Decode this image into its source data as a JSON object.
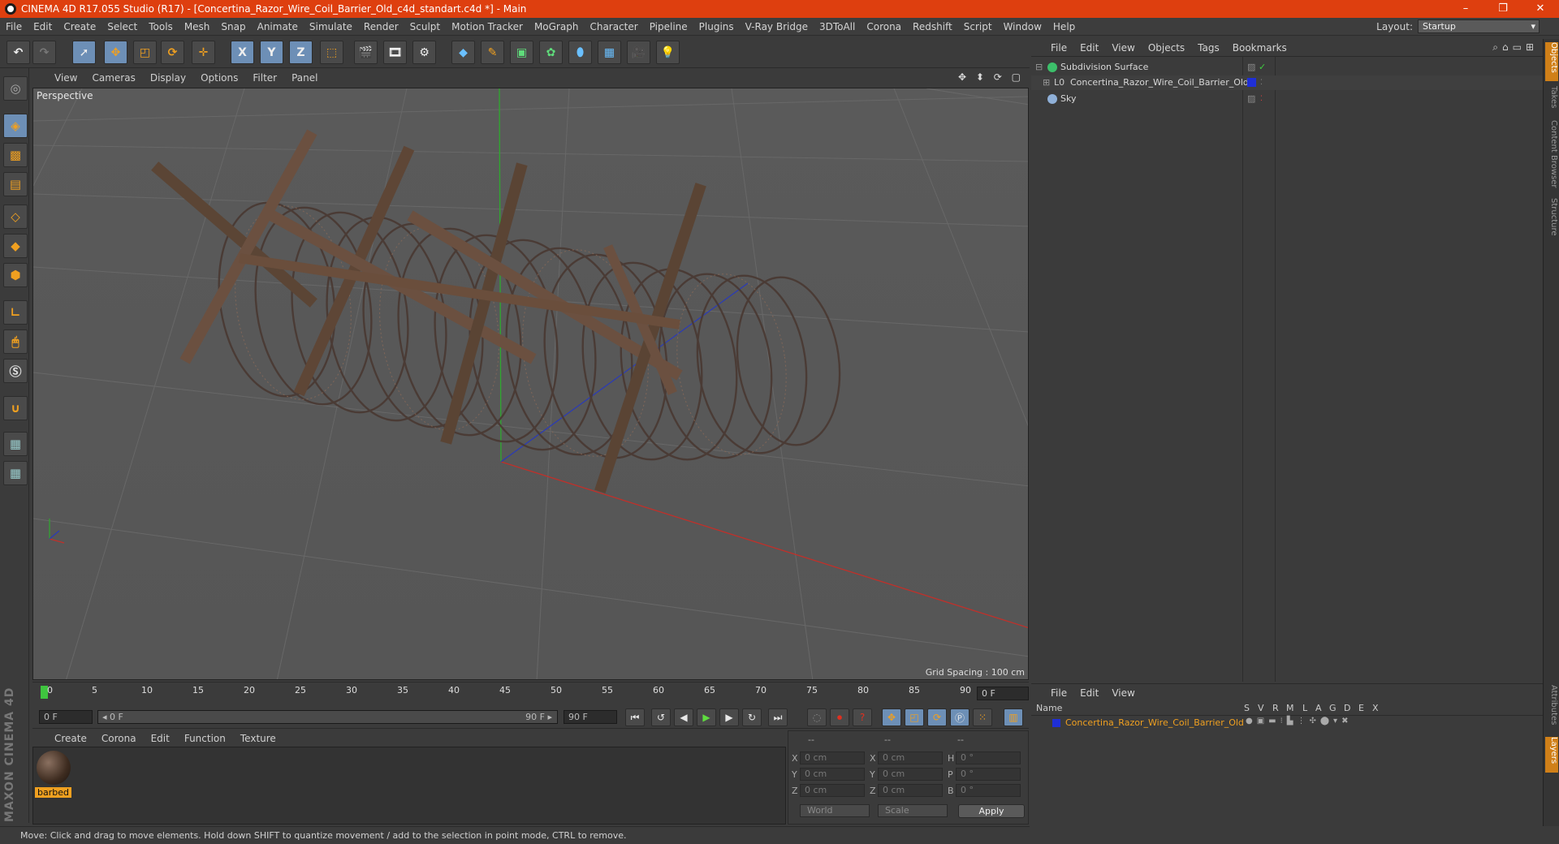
{
  "window": {
    "title": "CINEMA 4D R17.055 Studio (R17) - [Concertina_Razor_Wire_Coil_Barrier_Old_c4d_standart.c4d *] - Main",
    "controls": [
      "–",
      "❐",
      "✕"
    ]
  },
  "menu": {
    "items": [
      "File",
      "Edit",
      "Create",
      "Select",
      "Tools",
      "Mesh",
      "Snap",
      "Animate",
      "Simulate",
      "Render",
      "Sculpt",
      "Motion Tracker",
      "MoGraph",
      "Character",
      "Pipeline",
      "Plugins",
      "V-Ray Bridge",
      "3DToAll",
      "Corona",
      "Redshift",
      "Script",
      "Window",
      "Help"
    ],
    "layout_label": "Layout:",
    "layout_value": "Startup"
  },
  "toolbar": {
    "icons": [
      "undo-icon",
      "redo-icon",
      "live-selection-icon",
      "move-icon",
      "scale-icon",
      "rotate-icon",
      "recent-tool-icon",
      "x-axis-icon",
      "y-axis-icon",
      "z-axis-icon",
      "coordinate-system-icon",
      "render-view-icon",
      "render-picture-viewer-icon",
      "edit-render-settings-icon",
      "cube-icon",
      "pen-icon",
      "subdivision-icon",
      "mograph-cloner-icon",
      "deformer-icon",
      "floor-icon",
      "camera-icon",
      "light-icon"
    ],
    "axis_labels": [
      "X",
      "Y",
      "Z"
    ]
  },
  "left_toolbar": {
    "icons": [
      "make-editable-icon",
      "model-mode-icon",
      "texture-mode-icon",
      "workplane-icon",
      "points-mode-icon",
      "edges-mode-icon",
      "polygons-mode-icon",
      "axis-mode-icon",
      "tweak-mode-icon",
      "solo-mode-icon",
      "magnet-icon",
      "snap-lock-icon",
      "snap-settings-icon"
    ],
    "logo_text": "MAXON CINEMA 4D"
  },
  "viewport": {
    "menu": [
      "View",
      "Cameras",
      "Display",
      "Options",
      "Filter",
      "Panel"
    ],
    "label": "Perspective",
    "grid_spacing": "Grid Spacing : 100 cm",
    "nav_icons": "✥ ⬍ ⟳ ▢"
  },
  "timeline": {
    "ticks": [
      "0",
      "5",
      "10",
      "15",
      "20",
      "25",
      "30",
      "35",
      "40",
      "45",
      "50",
      "55",
      "60",
      "65",
      "70",
      "75",
      "80",
      "85",
      "90"
    ],
    "current_frame": "0 F"
  },
  "transport": {
    "start_frame": "0 F",
    "slider_start": "◂ 0 F",
    "slider_end": "90 F ▸",
    "end_frame": "90 F"
  },
  "material_manager": {
    "menu": [
      "Create",
      "Corona",
      "Edit",
      "Function",
      "Texture"
    ],
    "material_name": "barbed"
  },
  "coordinates": {
    "header": [
      "--",
      "--",
      "--"
    ],
    "rows": [
      {
        "a": "X",
        "av": "0 cm",
        "b": "X",
        "bv": "0 cm",
        "c": "H",
        "cv": "0 °"
      },
      {
        "a": "Y",
        "av": "0 cm",
        "b": "Y",
        "bv": "0 cm",
        "c": "P",
        "cv": "0 °"
      },
      {
        "a": "Z",
        "av": "0 cm",
        "b": "Z",
        "bv": "0 cm",
        "c": "B",
        "cv": "0 °"
      }
    ],
    "mode1": "World",
    "mode2": "Scale",
    "apply": "Apply"
  },
  "status": {
    "text": "Move: Click and drag to move elements. Hold down SHIFT to quantize movement / add to the selection in point mode, CTRL to remove."
  },
  "object_manager": {
    "menu": [
      "File",
      "Edit",
      "View",
      "Objects",
      "Tags",
      "Bookmarks"
    ],
    "objects": [
      {
        "name": "Subdivision Surface",
        "icon_color": "#3cbf6a"
      },
      {
        "name": "Concertina_Razor_Wire_Coil_Barrier_Old",
        "icon_color": "#c8c8c8",
        "tag_color": "#1f2fd6"
      },
      {
        "name": "Sky",
        "icon_color": "#8fb0d8"
      }
    ]
  },
  "layer_manager": {
    "menu": [
      "File",
      "Edit",
      "View"
    ],
    "columns": [
      "Name",
      "S",
      "V",
      "R",
      "M",
      "L",
      "A",
      "G",
      "D",
      "E",
      "X"
    ],
    "layer_name": "Concertina_Razor_Wire_Coil_Barrier_Old",
    "layer_color": "#1f2fd6"
  },
  "side_tabs": [
    "Objects",
    "Takes",
    "Content Browser",
    "Structure",
    "Attributes",
    "Layers"
  ],
  "colors": {
    "title_bar": "#de3f0f",
    "accent_orange": "#f0a020",
    "active_tool": "#6d8fb6"
  }
}
